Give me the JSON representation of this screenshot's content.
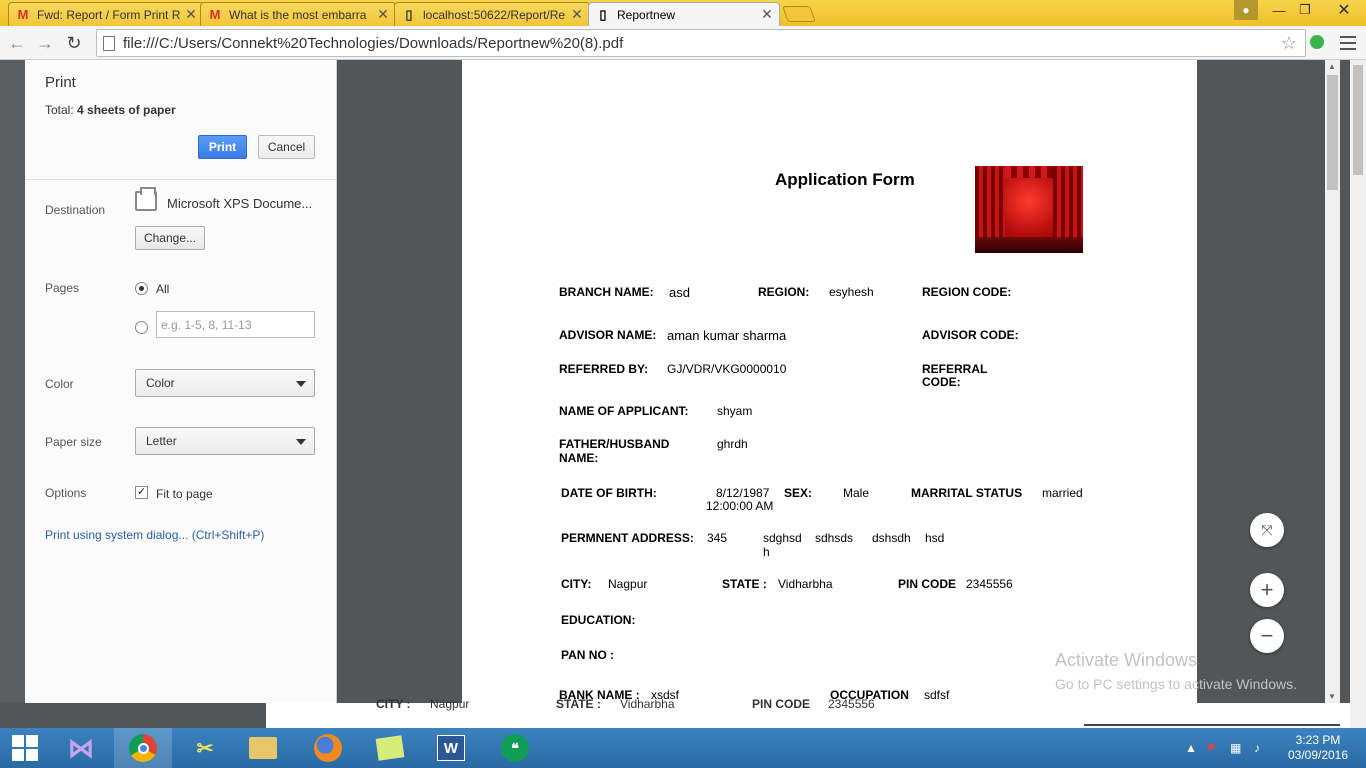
{
  "browser": {
    "tabs": [
      {
        "title": "Fwd: Report / Form Print R",
        "icon": "gmail-icon"
      },
      {
        "title": "What is the most embarra",
        "icon": "gmail-icon"
      },
      {
        "title": "localhost:50622/Report/Re",
        "icon": "page-icon"
      },
      {
        "title": "Reportnew",
        "icon": "page-icon"
      }
    ],
    "url": "file:///C:/Users/Connekt%20Technologies/Downloads/Reportnew%20(8).pdf"
  },
  "print_panel": {
    "title": "Print",
    "total_prefix": "Total: ",
    "total_value": "4 sheets of paper",
    "print_button": "Print",
    "cancel_button": "Cancel",
    "destination_label": "Destination",
    "destination_value": "Microsoft XPS Docume...",
    "change_button": "Change...",
    "pages_label": "Pages",
    "pages_all": "All",
    "pages_placeholder": "e.g. 1-5, 8, 11-13",
    "color_label": "Color",
    "color_value": "Color",
    "paper_label": "Paper size",
    "paper_value": "Letter",
    "options_label": "Options",
    "fit_label": "Fit to page",
    "fit_checked": true,
    "system_dialog": "Print using system dialog... (Ctrl+Shift+P)"
  },
  "form": {
    "title": "Application Form",
    "branch_label": "BRANCH NAME:",
    "branch_value": "asd",
    "region_label": "REGION:",
    "region_value": "esyhesh",
    "region_code_label": "REGION CODE:",
    "advisor_label": "ADVISOR NAME:",
    "advisor_value": "aman  kumar sharma",
    "advisor_code_label": "ADVISOR CODE:",
    "referred_label": "REFERRED BY:",
    "referred_value": "GJ/VDR/VKG0000010",
    "referral_label_1": "REFERRAL",
    "referral_label_2": "CODE:",
    "applicant_label": "NAME OF APPLICANT:",
    "applicant_value": "shyam",
    "father_label_1": "FATHER/HUSBAND",
    "father_label_2": "NAME:",
    "father_value": "ghrdh",
    "dob_label": "DATE OF BIRTH:",
    "dob_value_1": "8/12/1987",
    "dob_value_2": "12:00:00 AM",
    "sex_label": "SEX:",
    "sex_value": "Male",
    "marital_label": "MARRITAL STATUS",
    "marital_value": "married",
    "address_label": "PERMNENT ADDRESS:",
    "address_1": "345",
    "address_2": "sdghsd",
    "address_2b": "h",
    "address_3": "sdhsds",
    "address_4": "dshsdh",
    "address_5": "hsd",
    "city_label": "CITY:",
    "city_value": "Nagpur",
    "state_label": "STATE :",
    "state_value": "Vidharbha",
    "pin_label": "PIN CODE",
    "pin_value": "2345556",
    "education_label": "EDUCATION:",
    "pan_label": "PAN NO :",
    "bank_label": "BANK NAME :",
    "bank_value": "xsdsf",
    "occupation_label": "OCCUPATION",
    "occupation_value": "sdfsf"
  },
  "underlying": {
    "city_label": "CITY :",
    "city_value": "Nagpur",
    "state_label": "STATE :",
    "state_value": "Vidharbha",
    "pin_label": "PIN CODE",
    "pin_value": "2345556"
  },
  "watermark": {
    "line1": "Activate Windows",
    "line2": "Go to PC settings to activate Windows."
  },
  "taskbar": {
    "time": "3:23 PM",
    "date": "03/09/2016"
  }
}
